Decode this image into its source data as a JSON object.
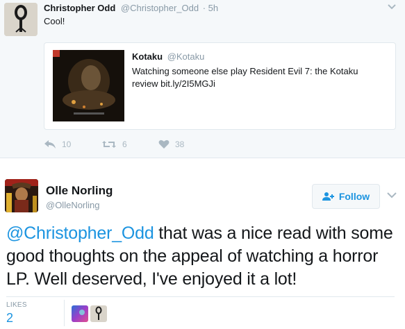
{
  "reply_tweet": {
    "author_name": "Christopher Odd",
    "author_handle": "@Christopher_Odd",
    "time": "· 5h",
    "text": "Cool!",
    "quoted": {
      "author_name": "Kotaku",
      "author_handle": "@Kotaku",
      "text": "Watching someone else play Resident Evil 7: the Kotaku review bit.ly/2I5MGJi"
    },
    "actions": {
      "replies": "10",
      "retweets": "6",
      "likes": "38"
    }
  },
  "main_tweet": {
    "author_name": "Olle Norling",
    "author_handle": "@OlleNorling",
    "follow_label": "Follow",
    "mention": "@Christopher_Odd",
    "text": " that was a nice read with some good thoughts on the appeal of watching a horror LP. Well deserved, I've enjoyed it a lot!",
    "likes_label": "LIKES",
    "likes_count": "2"
  },
  "colors": {
    "accent": "#1c94e0",
    "muted": "#8899a6",
    "background_reply": "#f5f8fa"
  },
  "icons": [
    "reply-icon",
    "retweet-icon",
    "heart-icon",
    "follow-person-icon",
    "chevron-down-icon"
  ]
}
